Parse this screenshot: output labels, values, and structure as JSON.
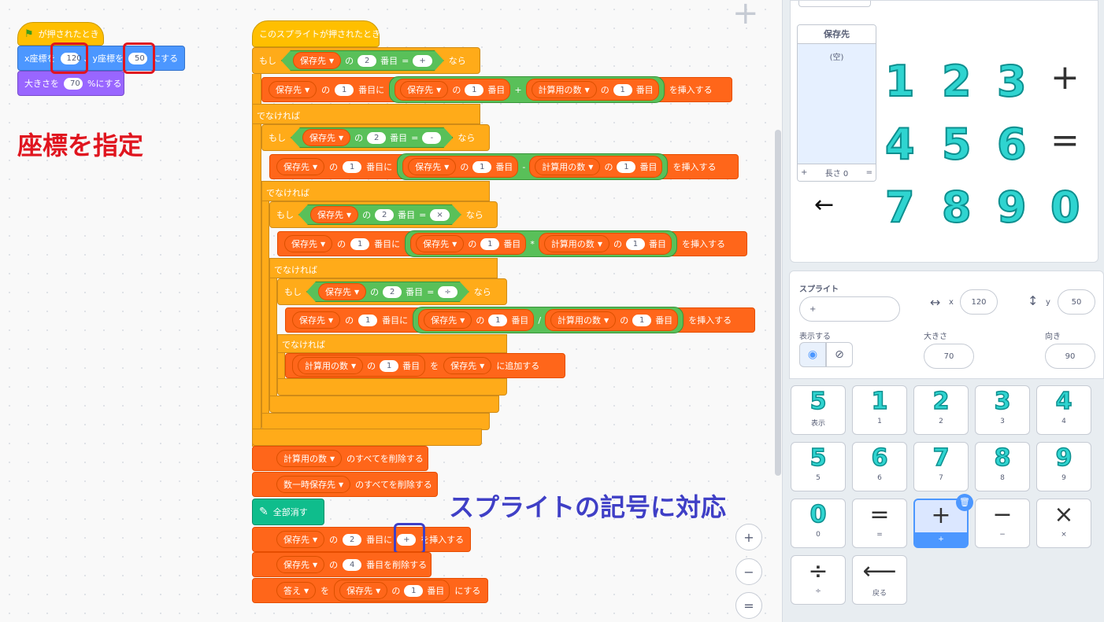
{
  "scripts": {
    "flag_hat": "が押されたとき",
    "goto": {
      "x_label": "x座標を",
      "x": "120",
      "y_label": "、y座標を",
      "y": "50",
      "suffix": "にする"
    },
    "size": {
      "prefix": "大きさを",
      "value": "70",
      "suffix": "%にする"
    },
    "sprite_hat": "このスプライトが押されたとき",
    "if": "もし",
    "then": "なら",
    "else": "でなければ",
    "list_store": "保存先",
    "list_calc": "計算用の数",
    "list_temp": "数一時保存先",
    "of": "の",
    "item": "番目",
    "insert_at": "番目に",
    "insert_suffix": "を挿入する",
    "one": "1",
    "two": "2",
    "four": "4",
    "eq": "=",
    "op_plus": "+",
    "op_minus": "-",
    "op_times": "×",
    "op_div": "÷",
    "ar_plus": "+",
    "ar_minus": "-",
    "ar_times": "*",
    "ar_div": "/",
    "to": "を",
    "add_to": "に追加する",
    "delete_all": "のすべてを削除する",
    "clear_all": "全部消す",
    "delete_item": "番目を削除する",
    "answer": "答え",
    "set_suffix": "にする"
  },
  "annotations": {
    "coords": "座標を指定",
    "symbol": "スプライトの記号に対応"
  },
  "zoom": {
    "in": "+",
    "out": "−",
    "reset": "="
  },
  "stage": {
    "list_title": "保存先",
    "list_empty": "(空)",
    "list_add": "+",
    "list_length": "長さ 0",
    "list_eq": "=",
    "arrow": "←",
    "numbers": [
      "1",
      "2",
      "3",
      "+",
      "4",
      "5",
      "6",
      "=",
      "7",
      "8",
      "9",
      "0"
    ]
  },
  "sprite_info": {
    "sprite_label": "スプライト",
    "sprite_name": "+",
    "x_label": "x",
    "x": "120",
    "y_label": "y",
    "y": "50",
    "show_label": "表示する",
    "size_label": "大きさ",
    "size": "70",
    "direction_label": "向き",
    "direction": "90"
  },
  "costumes": [
    {
      "glyph": "5",
      "caption": "表示"
    },
    {
      "glyph": "1",
      "caption": "1"
    },
    {
      "glyph": "2",
      "caption": "2"
    },
    {
      "glyph": "3",
      "caption": "3"
    },
    {
      "glyph": "4",
      "caption": "4"
    },
    {
      "glyph": "5",
      "caption": "5"
    },
    {
      "glyph": "6",
      "caption": "6"
    },
    {
      "glyph": "7",
      "caption": "7"
    },
    {
      "glyph": "8",
      "caption": "8"
    },
    {
      "glyph": "9",
      "caption": "9"
    },
    {
      "glyph": "0",
      "caption": "0"
    },
    {
      "glyph": "=",
      "caption": "="
    },
    {
      "glyph": "+",
      "caption": "+"
    },
    {
      "glyph": "−",
      "caption": "−"
    },
    {
      "glyph": "×",
      "caption": "×"
    },
    {
      "glyph": "÷",
      "caption": "÷"
    },
    {
      "glyph": "⟵",
      "caption": "戻る"
    }
  ],
  "colors": {
    "event": "#ffbf00",
    "motion": "#4c97ff",
    "looks": "#9966ff",
    "control": "#ffab19",
    "data": "#ff661a",
    "operator": "#59c059",
    "pen": "#0fbd8c",
    "annot_red": "#e0151f",
    "annot_blue": "#3f3fc6"
  }
}
